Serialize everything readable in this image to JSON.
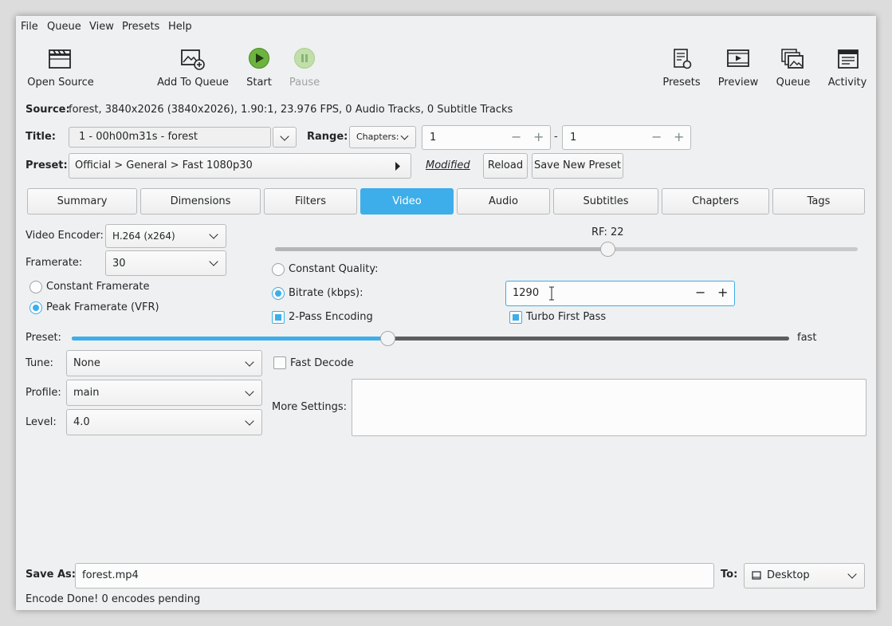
{
  "menu": [
    "File",
    "Queue",
    "View",
    "Presets",
    "Help"
  ],
  "toolbar": {
    "open_source": "Open Source",
    "add_to_queue": "Add To Queue",
    "start": "Start",
    "pause": "Pause",
    "presets": "Presets",
    "preview": "Preview",
    "queue": "Queue",
    "activity": "Activity"
  },
  "source": {
    "label": "Source:",
    "value": "forest, 3840x2026 (3840x2026), 1.90:1, 23.976 FPS, 0 Audio Tracks, 0 Subtitle Tracks"
  },
  "title_row": {
    "title_label": "Title:",
    "title_value": "1 - 00h00m31s - forest",
    "range_label": "Range:",
    "range_mode": "Chapters:",
    "range_start": "1",
    "range_sep": "-",
    "range_end": "1"
  },
  "preset_row": {
    "label": "Preset:",
    "value": "Official > General > Fast 1080p30",
    "modified": "Modified",
    "reload": "Reload",
    "save_new": "Save New Preset"
  },
  "tabs": [
    "Summary",
    "Dimensions",
    "Filters",
    "Video",
    "Audio",
    "Subtitles",
    "Chapters",
    "Tags"
  ],
  "active_tab": "Video",
  "video": {
    "encoder_label": "Video Encoder:",
    "encoder_value": "H.264 (x264)",
    "framerate_label": "Framerate:",
    "framerate_value": "30",
    "constant_framerate": "Constant Framerate",
    "peak_framerate": "Peak Framerate (VFR)",
    "rf_label": "RF: 22",
    "rf_level": 0.57,
    "constant_quality": "Constant Quality:",
    "bitrate_label": "Bitrate (kbps):",
    "bitrate_value": "1290",
    "two_pass": "2-Pass Encoding",
    "turbo": "Turbo First Pass",
    "preset_label": "Preset:",
    "preset_value": "fast",
    "preset_level": 0.44,
    "tune_label": "Tune:",
    "tune_value": "None",
    "fast_decode": "Fast Decode",
    "profile_label": "Profile:",
    "profile_value": "main",
    "level_label": "Level:",
    "level_value": "4.0",
    "more_settings": "More Settings:"
  },
  "save": {
    "label": "Save As:",
    "value": "forest.mp4",
    "to_label": "To:",
    "to_value": "Desktop"
  },
  "status": "Encode Done! 0 encodes pending",
  "colors": {
    "accent": "#3daee9",
    "window": "#eff0f1",
    "start_green": "#5aa02c"
  }
}
